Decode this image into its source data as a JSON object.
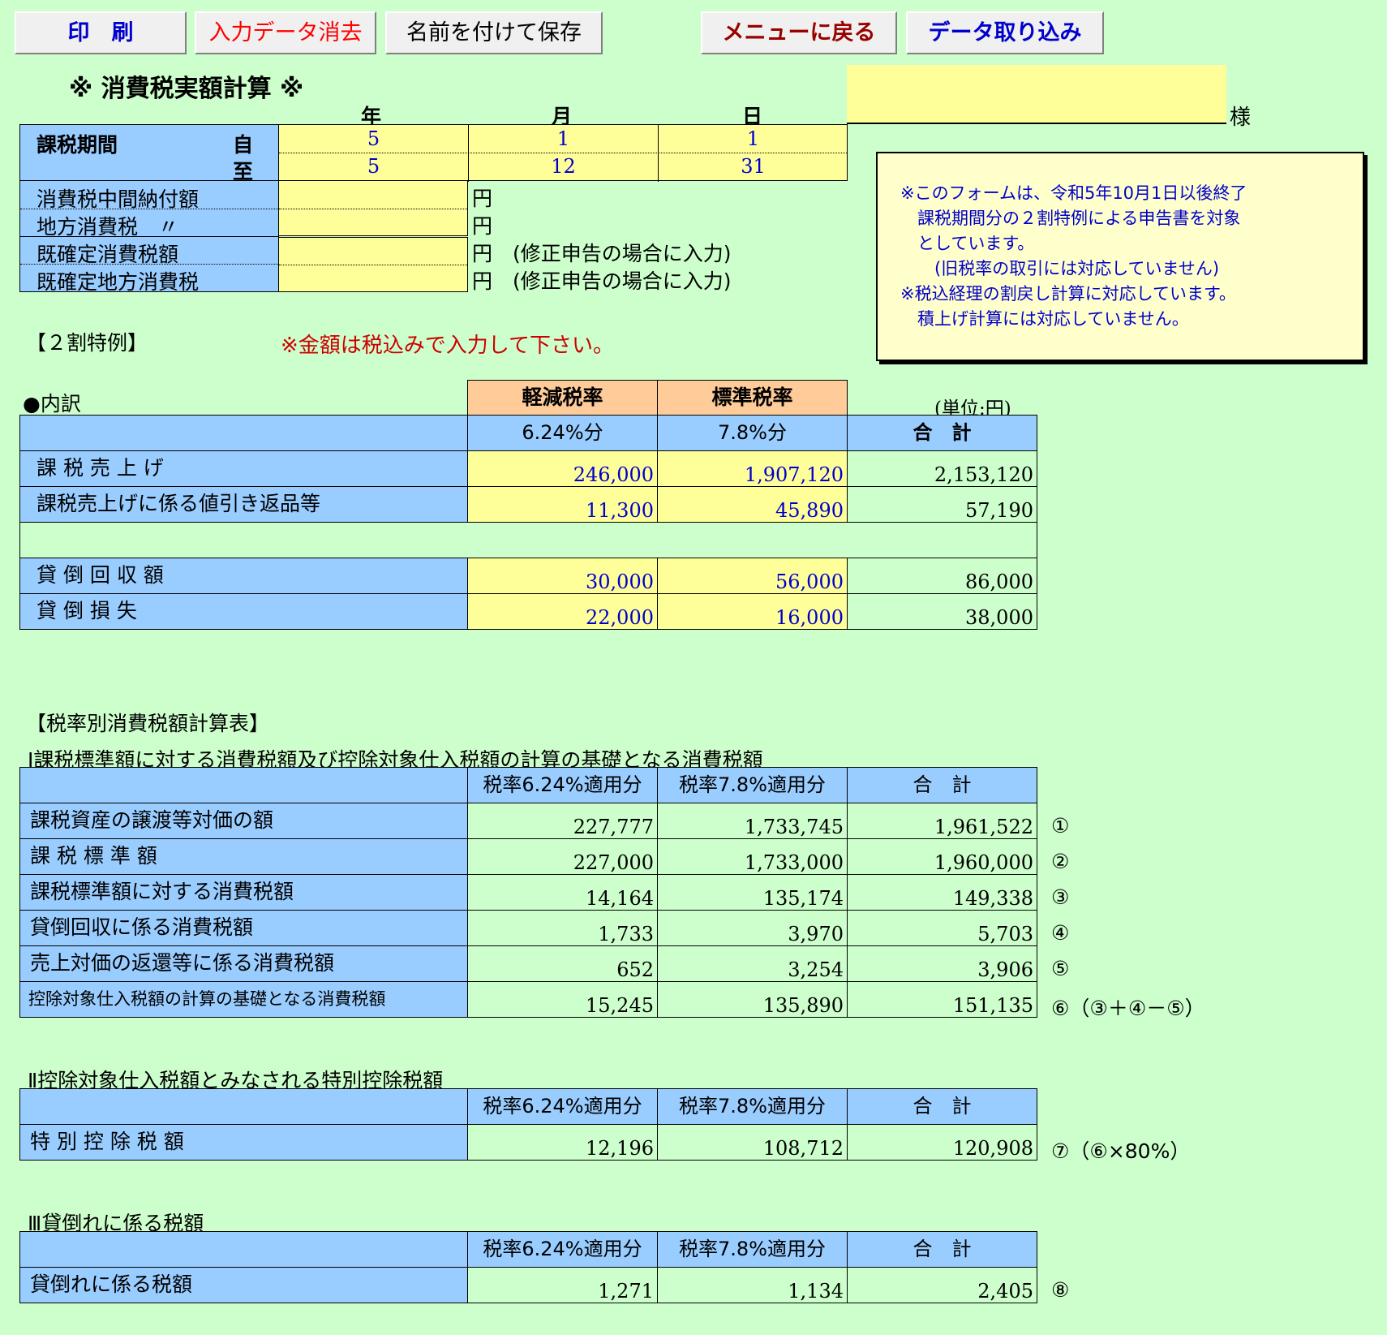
{
  "toolbar": {
    "print": "印　刷",
    "clear": "入力データ消去",
    "save_as": "名前を付けて保存",
    "back_menu": "メニューに戻る",
    "import": "データ取り込み"
  },
  "form": {
    "title": "※ 消費税実額計算 ※",
    "name_suffix": "様",
    "col_year": "年",
    "col_month": "月",
    "col_day": "日",
    "period_label": "課税期間",
    "from_label": "自",
    "to_label": "至",
    "from_year": "5",
    "from_month": "1",
    "from_day": "1",
    "to_year": "5",
    "to_month": "12",
    "to_day": "31",
    "interim_label": "消費税中間納付額",
    "local_label": "地方消費税　〃",
    "confirmed_label": "既確定消費税額",
    "confirmed_local_label": "既確定地方消費税",
    "yen": "円",
    "amend_note": "円　(修正申告の場合に入力)"
  },
  "notice": {
    "line1": "※このフォームは、令和5年10月1日以後終了",
    "line2": "　課税期間分の２割特例による申告書を対象",
    "line3": "　としています。",
    "line4": "　　(旧税率の取引には対応していません)",
    "line5": "※税込経理の割戻し計算に対応しています。",
    "line6": "　積上げ計算には対応していません。"
  },
  "section_tokurei": "【２割特例】",
  "tax_incl_note": "※金額は税込みで入力して下さい。",
  "breakdown": {
    "title": "●内訳",
    "unit": "(単位:円)",
    "h_reduced": "軽減税率",
    "h_standard": "標準税率",
    "h_624": "6.24%分",
    "h_78": "7.8%分",
    "h_total": "合　計",
    "rows": [
      {
        "label": "課 税 売 上 げ",
        "a": "246,000",
        "b": "1,907,120",
        "t": "2,153,120"
      },
      {
        "label": "課税売上げに係る値引き返品等",
        "a": "11,300",
        "b": "45,890",
        "t": "57,190"
      },
      {
        "label": "貸 倒 回 収 額",
        "a": "30,000",
        "b": "56,000",
        "t": "86,000"
      },
      {
        "label": "貸 倒 損 失",
        "a": "22,000",
        "b": "16,000",
        "t": "38,000"
      }
    ]
  },
  "calc": {
    "title": "【税率別消費税額計算表】",
    "h_624": "税率6.24%適用分",
    "h_78": "税率7.8%適用分",
    "h_total": "合　計",
    "sec1_title": "Ⅰ課税標準額に対する消費税額及び控除対象仕入税額の計算の基礎となる消費税額",
    "sec1_rows": [
      {
        "label": "課税資産の譲渡等対価の額",
        "a": "227,777",
        "b": "1,733,745",
        "t": "1,961,522",
        "mark": "①"
      },
      {
        "label": "課 税 標 準 額",
        "a": "227,000",
        "b": "1,733,000",
        "t": "1,960,000",
        "mark": "②"
      },
      {
        "label": "課税標準額に対する消費税額",
        "a": "14,164",
        "b": "135,174",
        "t": "149,338",
        "mark": "③"
      },
      {
        "label": "貸倒回収に係る消費税額",
        "a": "1,733",
        "b": "3,970",
        "t": "5,703",
        "mark": "④"
      },
      {
        "label": "売上対価の返還等に係る消費税額",
        "a": "652",
        "b": "3,254",
        "t": "3,906",
        "mark": "⑤"
      },
      {
        "label": "控除対象仕入税額の計算の基礎となる消費税額",
        "a": "15,245",
        "b": "135,890",
        "t": "151,135",
        "mark": "⑥（③＋④－⑤）"
      }
    ],
    "sec2_title": "Ⅱ控除対象仕入税額とみなされる特別控除税額",
    "sec2_row": {
      "label": "特 別 控 除 税 額",
      "a": "12,196",
      "b": "108,712",
      "t": "120,908",
      "mark": "⑦（⑥×80%）"
    },
    "sec3_title": "Ⅲ貸倒れに係る税額",
    "sec3_row": {
      "label": "貸倒れに係る税額",
      "a": "1,271",
      "b": "1,134",
      "t": "2,405",
      "mark": "⑧"
    }
  },
  "colors": {
    "background": "#ccffcc",
    "label_blue": "#99ccff",
    "input_yellow": "#ffff99",
    "header_peach": "#ffcc99",
    "notice_bg": "#ffffcc",
    "red_text": "#cc0000",
    "blue_text": "#0000cc"
  }
}
